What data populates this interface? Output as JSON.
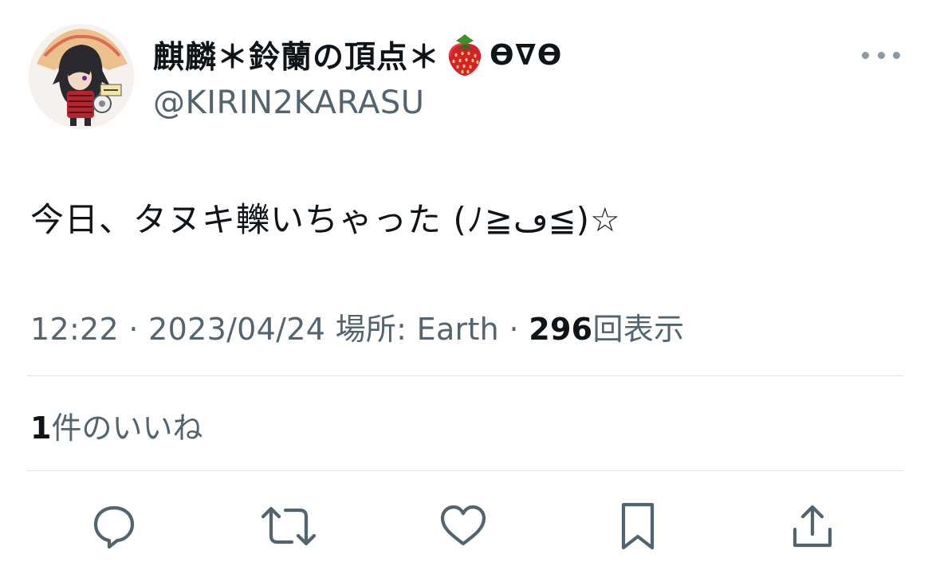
{
  "user": {
    "display_name": "麒麟＊鈴蘭の頂点＊",
    "display_name_emoji": "strawberry-emoji",
    "display_name_suffix": "ϴ∇ϴ",
    "handle": "@KIRIN2KARASU",
    "avatar": "avatar-image"
  },
  "tweet": {
    "text": "今日、タヌキ轢いちゃった (ﾉ≧ڡ≦)☆"
  },
  "meta": {
    "time": "12:22",
    "sep1": " · ",
    "date": "2023/04/24",
    "location": " 場所: Earth",
    "sep2": " · ",
    "views_count": "296",
    "views_label": "回表示"
  },
  "likes": {
    "count": "1",
    "label": "件のいいね"
  },
  "actions": [
    {
      "name": "reply",
      "icon": "reply-icon"
    },
    {
      "name": "retweet",
      "icon": "retweet-icon"
    },
    {
      "name": "like",
      "icon": "heart-icon"
    },
    {
      "name": "bookmark",
      "icon": "bookmark-icon"
    },
    {
      "name": "share",
      "icon": "share-icon"
    }
  ],
  "colors": {
    "text": "#0f1419",
    "secondary": "#536471",
    "divider": "#dfe3e6",
    "icon": "#536471"
  }
}
